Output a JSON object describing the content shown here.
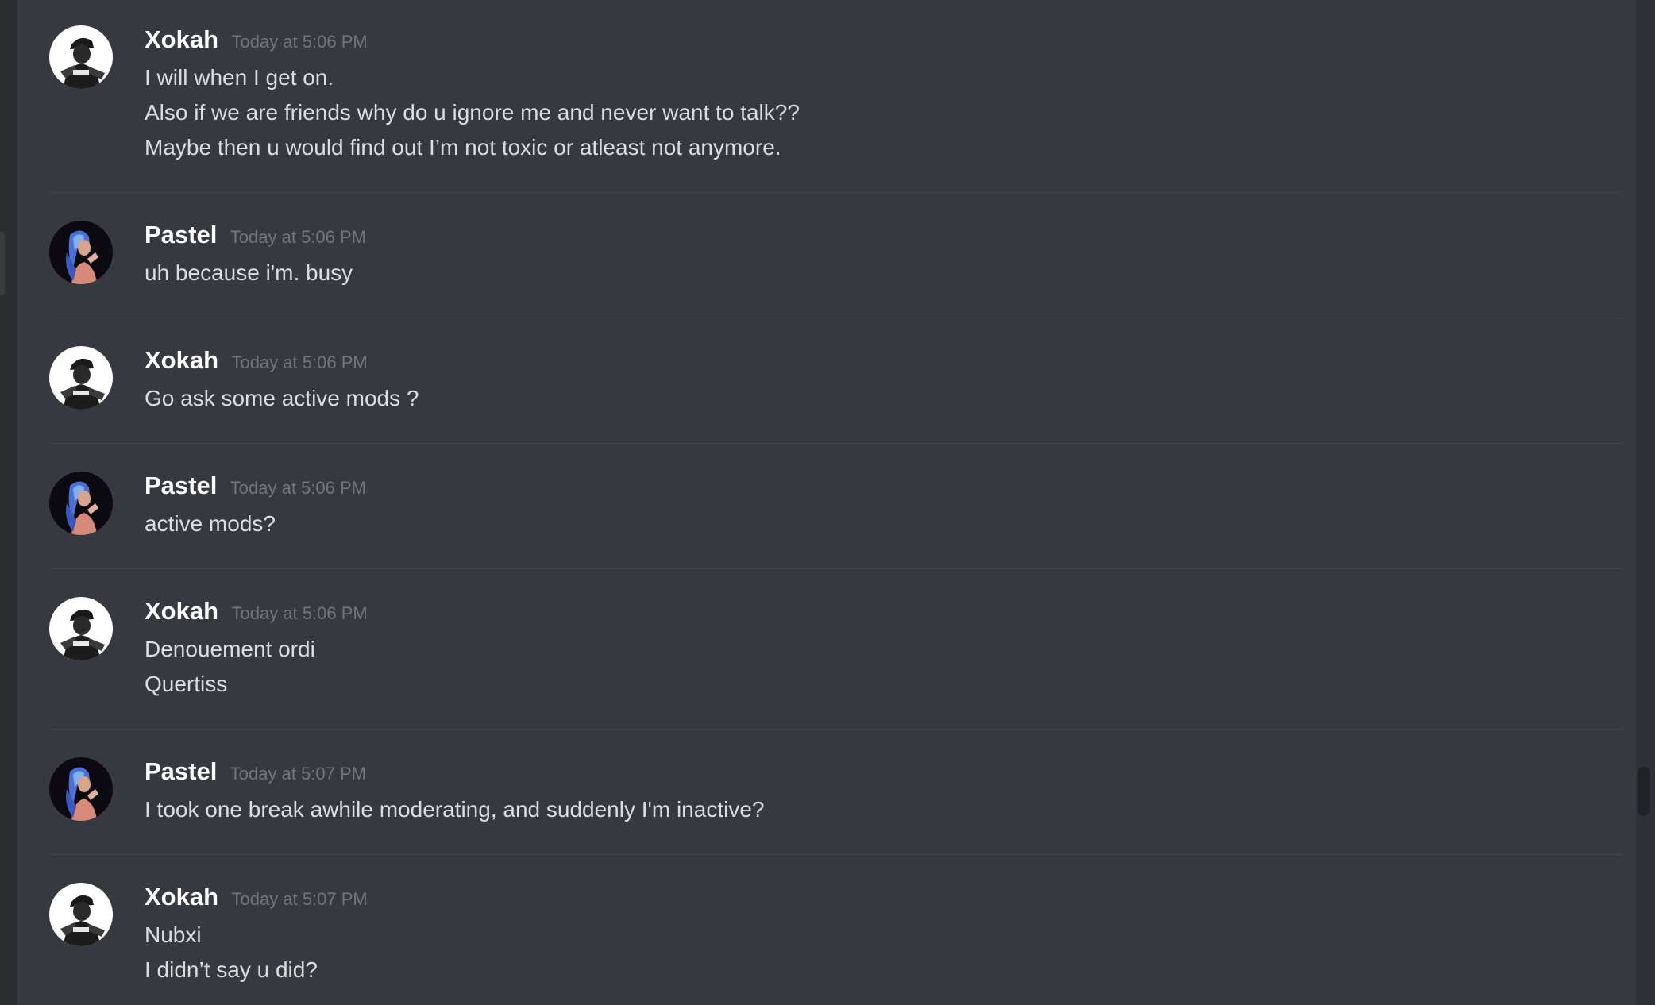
{
  "messages": [
    {
      "author": "Xokah",
      "avatar_icon": "avatar-xokah-icon",
      "timestamp": "Today at 5:06 PM",
      "lines": [
        "I will when I get on.",
        "Also if we are friends why do u ignore me and never want to talk??",
        "Maybe then u would find out I’m not toxic or atleast not anymore."
      ]
    },
    {
      "author": "Pastel",
      "avatar_icon": "avatar-pastel-icon",
      "timestamp": "Today at 5:06 PM",
      "lines": [
        "uh because i'm. busy"
      ]
    },
    {
      "author": "Xokah",
      "avatar_icon": "avatar-xokah-icon",
      "timestamp": "Today at 5:06 PM",
      "lines": [
        "Go ask some active mods ?"
      ]
    },
    {
      "author": "Pastel",
      "avatar_icon": "avatar-pastel-icon",
      "timestamp": "Today at 5:06 PM",
      "lines": [
        "active mods?"
      ]
    },
    {
      "author": "Xokah",
      "avatar_icon": "avatar-xokah-icon",
      "timestamp": "Today at 5:06 PM",
      "lines": [
        "Denouement ordi",
        "Quertiss"
      ]
    },
    {
      "author": "Pastel",
      "avatar_icon": "avatar-pastel-icon",
      "timestamp": "Today at 5:07 PM",
      "lines": [
        "I took one break awhile moderating, and suddenly I'm inactive?"
      ]
    },
    {
      "author": "Xokah",
      "avatar_icon": "avatar-xokah-icon",
      "timestamp": "Today at 5:07 PM",
      "lines": [
        "Nubxi",
        "I didn’t say u did?"
      ]
    }
  ],
  "colors": {
    "background": "#36393f",
    "username": "#ffffff",
    "timestamp": "#72767d",
    "message_text": "#dcddde",
    "divider": "#40444b"
  }
}
